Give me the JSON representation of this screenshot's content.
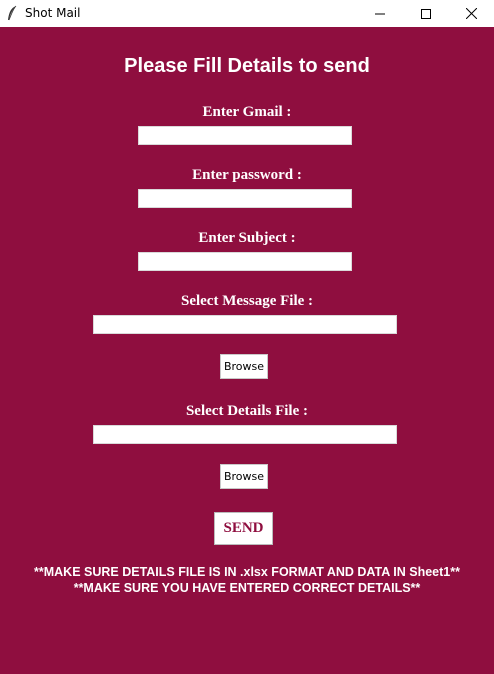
{
  "window": {
    "title": "Shot Mail",
    "minimize_icon": "minimize-icon",
    "maximize_icon": "maximize-icon",
    "close_icon": "close-icon",
    "app_icon": "feather-icon"
  },
  "colors": {
    "background": "#8f0e3f",
    "text": "#ffffff",
    "send_text": "#8f0e3f"
  },
  "form": {
    "heading": "Please Fill Details to send",
    "gmail_label": "Enter Gmail :",
    "gmail_value": "",
    "password_label": "Enter password :",
    "password_value": "",
    "subject_label": "Enter Subject :",
    "subject_value": "",
    "message_file_label": "Select Message File :",
    "message_file_value": "",
    "message_browse_label": "Browse",
    "details_file_label": "Select Details File :",
    "details_file_value": "",
    "details_browse_label": "Browse",
    "send_label": "SEND"
  },
  "notes": {
    "line1": "**MAKE SURE DETAILS FILE IS IN .xlsx FORMAT AND DATA IN Sheet1**",
    "line2": "**MAKE SURE YOU HAVE ENTERED CORRECT DETAILS**"
  }
}
